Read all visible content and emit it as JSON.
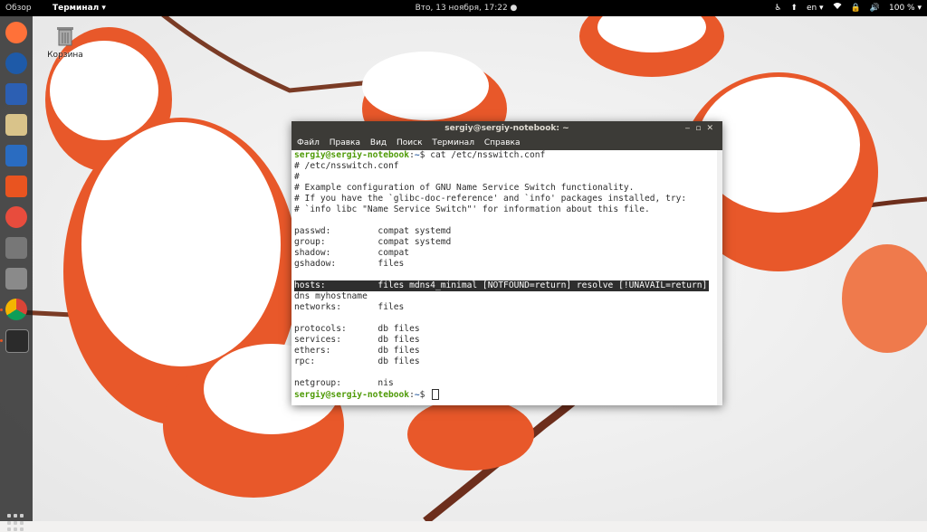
{
  "topbar": {
    "activities": "Обзор",
    "app_menu": "Терминал ▾",
    "clock": "Вто, 13 ноября, 17:22 ●",
    "lang": "en ▾",
    "battery": "100 % ▾"
  },
  "desktop": {
    "trash_label": "Корзина"
  },
  "terminal": {
    "title": "sergiy@sergiy-notebook: ~",
    "menu": [
      "Файл",
      "Правка",
      "Вид",
      "Поиск",
      "Терминал",
      "Справка"
    ],
    "prompt_user": "sergiy@sergiy-notebook",
    "prompt_path": "~",
    "prompt_sign": "$",
    "command": " cat /etc/nsswitch.conf",
    "lines": [
      "# /etc/nsswitch.conf",
      "#",
      "# Example configuration of GNU Name Service Switch functionality.",
      "# If you have the `glibc-doc-reference' and `info' packages installed, try:",
      "# `info libc \"Name Service Switch\"' for information about this file.",
      "",
      "passwd:         compat systemd",
      "group:          compat systemd",
      "shadow:         compat",
      "gshadow:        files",
      "",
      "hosts:          files mdns4_minimal [NOTFOUND=return] resolve [!UNAVAIL=return]",
      "dns myhostname",
      "networks:       files",
      "",
      "protocols:      db files",
      "services:       db files",
      "ethers:         db files",
      "rpc:            db files",
      "",
      "netgroup:       nis"
    ]
  },
  "colors": {
    "topbar_bg": "#000000",
    "dock_bg": "#1e1e1e",
    "title_bg": "#3c3b37",
    "prompt_user": "#4e9a06",
    "prompt_path": "#3465a4",
    "accent": "#e95420"
  },
  "dock": {
    "icons": [
      "firefox-icon",
      "thunderbird-icon",
      "files-icon",
      "rhythmbox-icon",
      "libreoffice-writer-icon",
      "software-center-icon",
      "help-icon",
      "disks-icon",
      "settings-tools-icon",
      "chrome-icon",
      "terminal-icon"
    ]
  }
}
